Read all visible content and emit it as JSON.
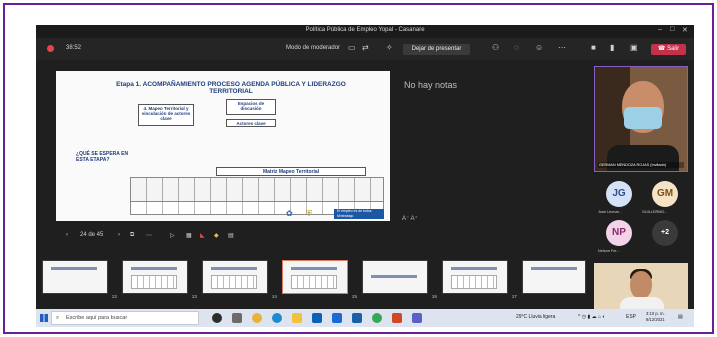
{
  "window": {
    "title": "Política Pública de Empleo Yopal - Casanare",
    "controls": {
      "minimize": "–",
      "maximize": "□",
      "close": "✕"
    }
  },
  "toolbar": {
    "timer": "38:52",
    "mode_label": "Modo de moderador",
    "present_button": "Dejar de presentar",
    "leave_button": "Salir",
    "icons": [
      "monitor-icon",
      "sync-icon",
      "people-icon",
      "chat-icon",
      "reactions-icon",
      "more-icon",
      "camera-icon",
      "mic-icon",
      "share-icon",
      "phone-icon"
    ]
  },
  "slide": {
    "title": "Etapa 1. ACOMPAÑAMIENTO PROCESO AGENDA PÚBLICA Y LIDERAZGO TERRITORIAL",
    "box1": "4. Mapeo Territorial y vinculación de actores clave",
    "box2": "Espacios de discusión",
    "box3": "Actores clave",
    "question": "¿QUÉ SE ESPERA EN ESTA ETAPA?",
    "matrix_title": "Matriz Mapeo Territorial",
    "logo_text": "El empleo es de todos",
    "logo_text2": "Mintrabajo"
  },
  "notes": {
    "empty_text": "No hay notas",
    "text_size": "A⁻  A⁺"
  },
  "slide_nav": {
    "counter": "24 de 45"
  },
  "participants": {
    "main_video_name": "GERMAN MENDOZA ROJAS (Invitado)",
    "avatars": [
      {
        "initials": "JG",
        "name": "Jose Leonar...",
        "bg": "#d4e1f7",
        "fg": "#2b4f8f"
      },
      {
        "initials": "GM",
        "name": "GUILLERMO...",
        "bg": "#f6e3c6",
        "fg": "#7a4f12"
      },
      {
        "initials": "NP",
        "name": "Nelson Fer...",
        "bg": "#f3d3ea",
        "fg": "#8a2a6e"
      },
      {
        "initials": "+2",
        "name": "",
        "bg": "#3a3a3a",
        "fg": "#ffffff"
      }
    ]
  },
  "thumbnails": {
    "numbers": [
      "22",
      "23",
      "24",
      "25",
      "26",
      "27"
    ]
  },
  "taskbar": {
    "search_placeholder": "Escribe aquí para buscar",
    "weather": "29°C  Lluvia ligera",
    "lang": "ESP",
    "time": "3:10 p. m.",
    "date": "8/12/2021"
  },
  "colors": {
    "frame": "#6a1f95",
    "leave": "#c4314b",
    "slide_title": "#1f3e7a"
  }
}
